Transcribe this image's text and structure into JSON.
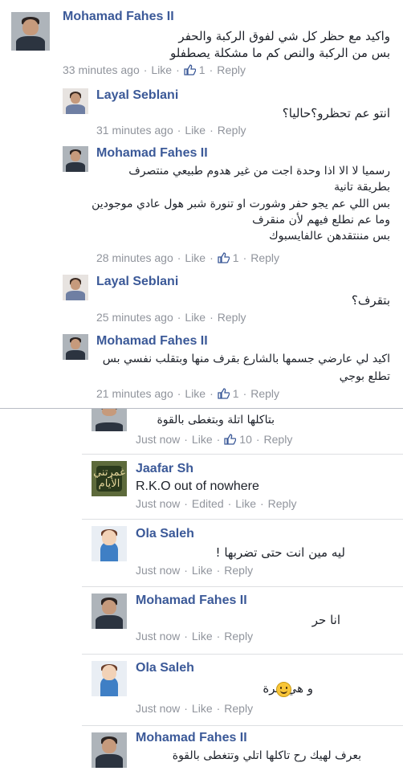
{
  "actions": {
    "like": "Like",
    "reply": "Reply",
    "edited": "Edited",
    "separator": "·"
  },
  "comments": [
    {
      "name": "Mohamad Fahes II",
      "lines": [
        "واكيد مع حظر كل شي لفوق الركبة والحفر",
        "بس من الركبة والنص كم ما مشكلة يصطفلو"
      ],
      "time": "33 minutes ago",
      "likes": "1"
    },
    {
      "name": "Layal Seblani",
      "lines": [
        "انتو عم تحظرو؟حاليا؟"
      ],
      "time": "31 minutes ago"
    },
    {
      "name": "Mohamad Fahes II",
      "lines": [
        "رسميا لا الا اذا وحدة اجت من غير هدوم طبيعي منتصرف",
        "بطريقة تانية",
        "بس اللي عم يجو حفر وشورت او تنورة شبر هول عادي موجودين",
        "وما عم نطلع فيهم لأن منقرف",
        "بس مننتقدهن عالفايسبوك"
      ],
      "time": "28 minutes ago",
      "likes": "1"
    },
    {
      "name": "Layal Seblani",
      "lines": [
        "بتقرف؟"
      ],
      "time": "25 minutes ago"
    },
    {
      "name": "Mohamad Fahes II",
      "lines": [
        "اكيد لي عارضي جسمها بالشارع بقرف منها وبتقلب نفسي بس",
        "تطلع بوجي"
      ],
      "time": "21 minutes ago",
      "likes": "1"
    }
  ],
  "replies": [
    {
      "lines": [
        "بتاكلها اتلة وبتغطى بالقوة"
      ],
      "time": "Just now",
      "likes": "10"
    },
    {
      "name": "Jaafar Sh",
      "avatar_text": "غمرتني الأيام",
      "lines": [
        "R.K.O out of nowhere"
      ],
      "time": "Just now"
    },
    {
      "name": "Ola Saleh",
      "lines": [
        "ليه مين انت حتى تضربها !"
      ],
      "time": "Just now"
    },
    {
      "name": "Mohamad Fahes II",
      "lines": [
        "انا حر"
      ],
      "time": "Just now"
    },
    {
      "name": "Ola Saleh",
      "lines": [
        "و هي حرة"
      ],
      "emoji": "smiling-face-emoji",
      "time": "Just now"
    },
    {
      "name": "Mohamad Fahes II",
      "lines": [
        "بعرف لهيك رح تاكلها اتلي وتتغطى بالقوة"
      ]
    }
  ],
  "colors": {
    "name": "#3b5998",
    "meta": "#90949c",
    "text": "#1d2129",
    "divider": "#b8bcc4"
  }
}
